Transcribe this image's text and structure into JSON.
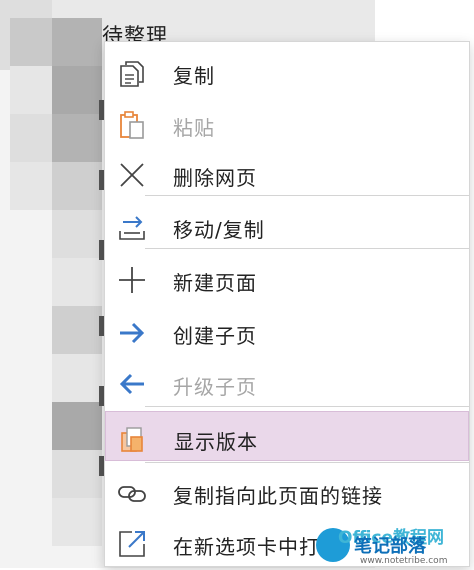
{
  "background": {
    "page_title": "待整理"
  },
  "menu": {
    "items": [
      {
        "label": "复制",
        "icon": "copy-icon",
        "enabled": true
      },
      {
        "label": "粘贴",
        "icon": "paste-icon",
        "enabled": false
      },
      {
        "label": "删除网页",
        "icon": "close-icon",
        "enabled": true
      },
      {
        "label": "移动/复制",
        "icon": "move-copy-icon",
        "enabled": true
      },
      {
        "label": "新建页面",
        "icon": "plus-icon",
        "enabled": true
      },
      {
        "label": "创建子页",
        "icon": "arrow-right-icon",
        "enabled": true
      },
      {
        "label": "升级子页",
        "icon": "arrow-left-icon",
        "enabled": false
      },
      {
        "label": "显示版本",
        "icon": "versions-icon",
        "enabled": true,
        "highlighted": true
      },
      {
        "label": "复制指向此页面的链接",
        "icon": "link-icon",
        "enabled": true
      },
      {
        "label": "在新选项卡中打开",
        "icon": "open-new-tab-icon",
        "enabled": true
      }
    ],
    "colors": {
      "highlight": "#ead8ea",
      "blue_arrow": "#3a78c9",
      "orange_icon": "#e8853a",
      "text": "#222222",
      "disabled_text": "#a6a6a6"
    }
  },
  "watermark": {
    "brand": "Office教程网",
    "name": "笔记部落",
    "url": "www.notetribe.com"
  }
}
